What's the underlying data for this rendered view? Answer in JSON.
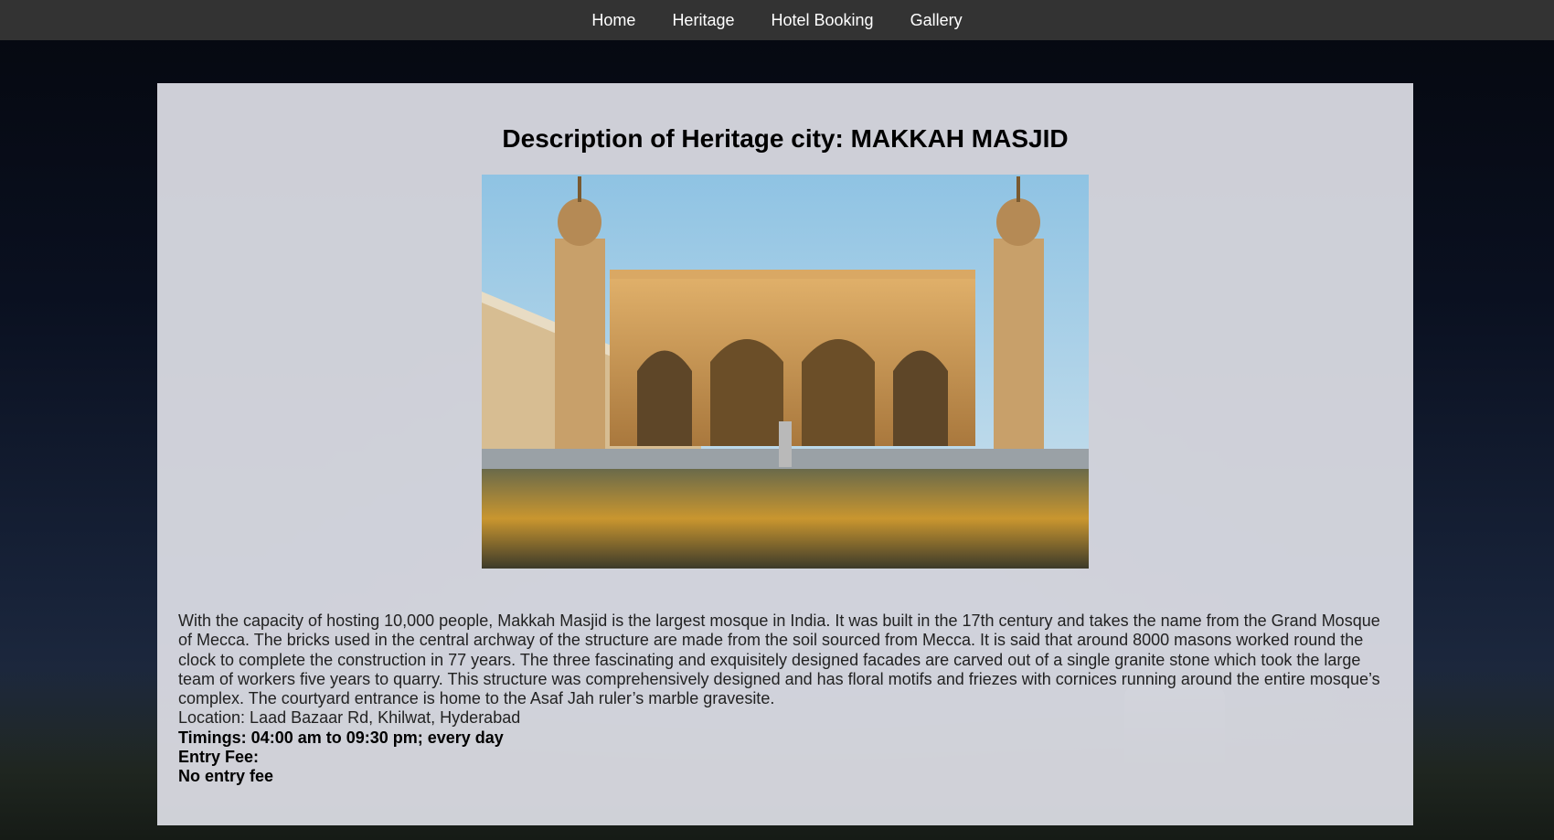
{
  "nav": {
    "items": [
      "Home",
      "Heritage",
      "Hotel Booking",
      "Gallery"
    ]
  },
  "page": {
    "title": "Description of Heritage city: MAKKAH MASJID",
    "image_alt": "Makkah Masjid",
    "description": "With the capacity of hosting 10,000 people, Makkah Masjid is the largest mosque in India. It was built in the 17th century and takes the name from the Grand Mosque of Mecca. The bricks used in the central archway of the structure are made from the soil sourced from Mecca. It is said that around 8000 masons worked round the clock to complete the construction in 77 years. The three fascinating and exquisitely designed facades are carved out of a single granite stone which took the large team of workers five years to quarry. This structure was comprehensively designed and has floral motifs and friezes with cornices running around the entire mosque’s complex. The courtyard entrance is home to the Asaf Jah ruler’s marble gravesite.",
    "location": "Location: Laad Bazaar Rd, Khilwat, Hyderabad",
    "timings": "Timings: 04:00 am to 09:30 pm; every day",
    "entry_fee_label": "Entry Fee:",
    "entry_fee_value": "No entry fee"
  },
  "colors": {
    "navbar": "#333333",
    "panel": "#dedfe6",
    "sky": "#a9d0e8",
    "stone": "#c99a55"
  }
}
